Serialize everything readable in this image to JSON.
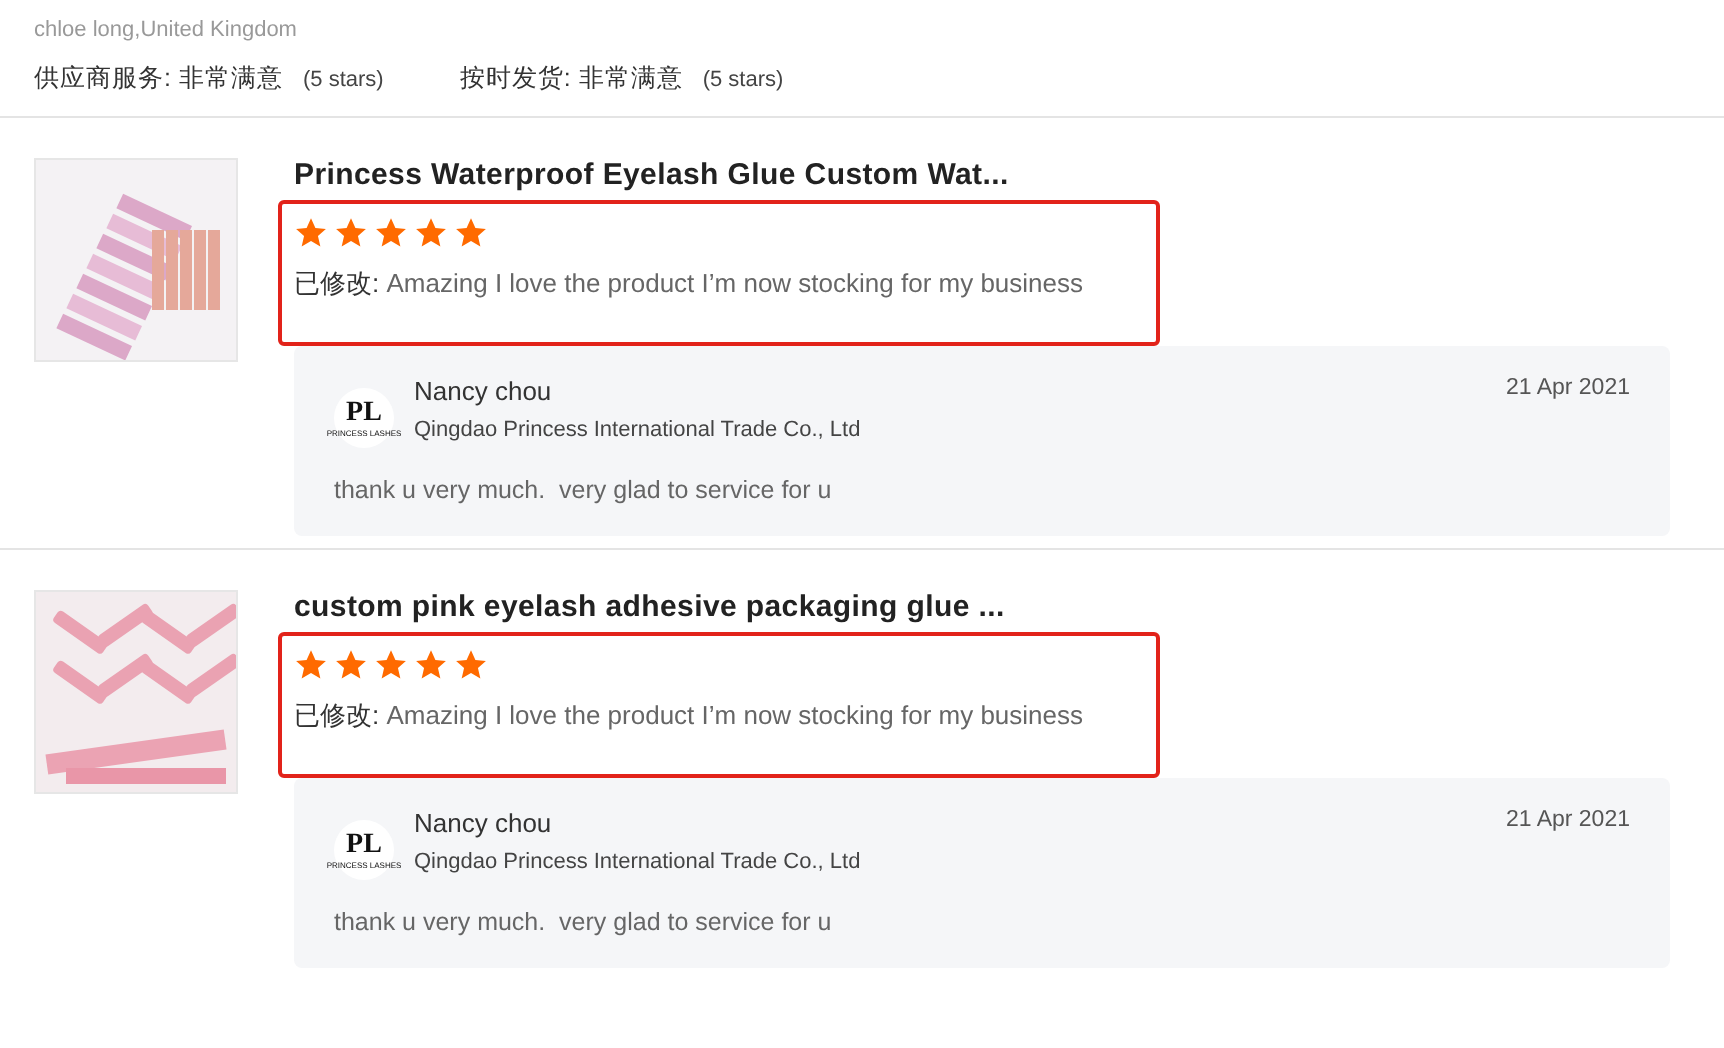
{
  "buyer": {
    "name": "chloe long,United Kingdom",
    "ratings": [
      {
        "label": "供应商服务:",
        "value": "非常满意",
        "stars_text": "(5 stars)"
      },
      {
        "label": "按时发货:",
        "value": "非常满意",
        "stars_text": "(5 stars)"
      }
    ]
  },
  "reviews": [
    {
      "product": "Princess Waterproof Eyelash Glue Custom Wat...",
      "highlighted": true,
      "stars": 5,
      "edited_label": "已修改:",
      "text": "Amazing I love the product I’m now stocking for my business",
      "reply": {
        "logo": "PL",
        "logo_sub": "PRINCESS LASHES",
        "name": "Nancy chou",
        "company": "Qingdao Princess International Trade Co., Ltd",
        "date": "21 Apr 2021",
        "text": "thank u very much.  very glad to service for u"
      }
    },
    {
      "product": "custom pink eyelash adhesive packaging glue ...",
      "highlighted": true,
      "stars": 5,
      "edited_label": "已修改:",
      "text": "Amazing I love the product I’m now stocking for my business",
      "reply": {
        "logo": "PL",
        "logo_sub": "PRINCESS LASHES",
        "name": "Nancy chou",
        "company": "Qingdao Princess International Trade Co., Ltd",
        "date": "21 Apr 2021",
        "text": "thank u very much.  very glad to service for u"
      }
    }
  ]
}
